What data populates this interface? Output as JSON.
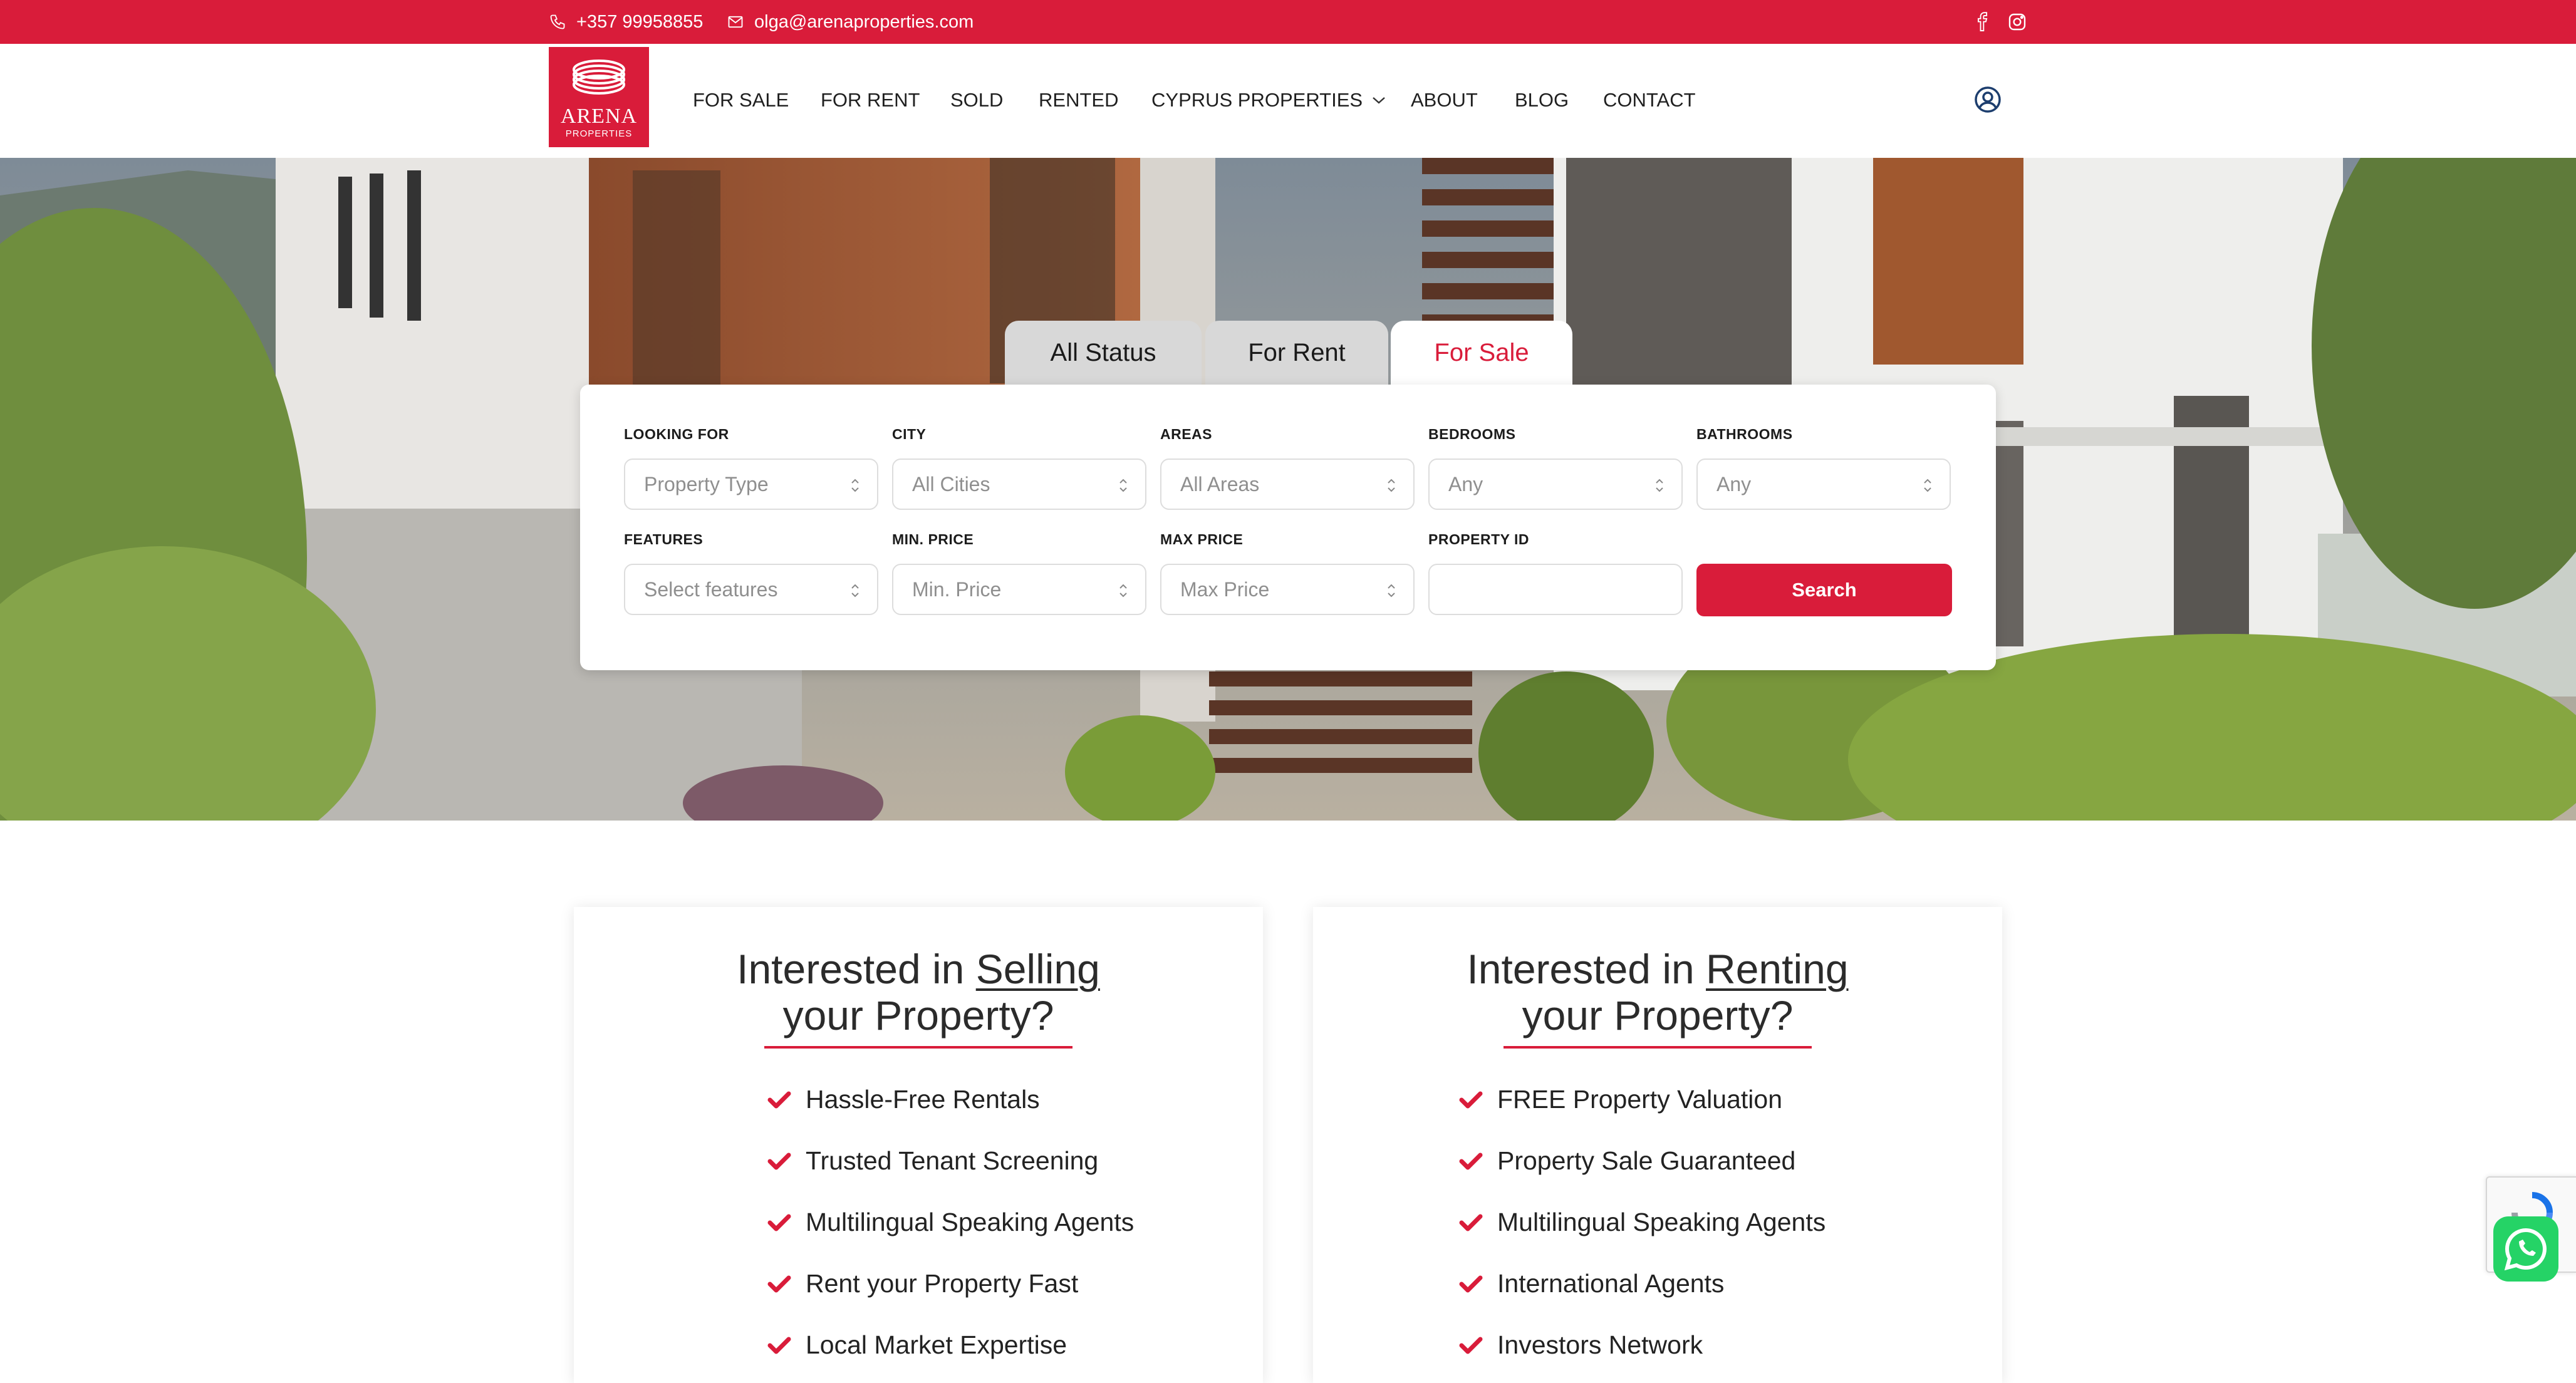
{
  "topbar": {
    "phone": "+357 99958855",
    "email": "olga@arenaproperties.com",
    "social": [
      "facebook-icon",
      "instagram-icon"
    ]
  },
  "brand": {
    "name": "ARENA",
    "sub": "PROPERTIES",
    "color": "#d91c3a"
  },
  "nav": {
    "items": [
      "FOR SALE",
      "FOR RENT",
      "SOLD",
      "RENTED",
      "CYPRUS PROPERTIES",
      "ABOUT",
      "BLOG",
      "CONTACT"
    ]
  },
  "search": {
    "tabs": [
      {
        "label": "All Status",
        "active": false
      },
      {
        "label": "For Rent",
        "active": false
      },
      {
        "label": "For Sale",
        "active": true
      }
    ],
    "fields": {
      "looking_for": {
        "label": "LOOKING FOR",
        "value": "Property Type"
      },
      "city": {
        "label": "CITY",
        "value": "All Cities"
      },
      "areas": {
        "label": "AREAS",
        "value": "All Areas"
      },
      "bedrooms": {
        "label": "BEDROOMS",
        "value": "Any"
      },
      "bathrooms": {
        "label": "BATHROOMS",
        "value": "Any"
      },
      "features": {
        "label": "FEATURES",
        "value": "Select features"
      },
      "min_price": {
        "label": "MIN. PRICE",
        "value": "Min. Price"
      },
      "max_price": {
        "label": "MAX PRICE",
        "value": "Max Price"
      },
      "property_id": {
        "label": "PROPERTY ID",
        "value": ""
      }
    },
    "button": "Search"
  },
  "cards": {
    "selling": {
      "title_pre": "Interested in ",
      "title_em": "Selling",
      "title_post": "your Property?",
      "items": [
        "Hassle-Free Rentals",
        "Trusted Tenant Screening",
        "Multilingual Speaking Agents",
        "Rent your Property Fast",
        "Local Market Expertise"
      ]
    },
    "renting": {
      "title_pre": "Interested in ",
      "title_em": "Renting",
      "title_post": "your Property?",
      "items": [
        "FREE Property Valuation",
        "Property Sale Guaranteed",
        "Multilingual Speaking Agents",
        "International Agents",
        "Investors Network"
      ]
    }
  }
}
